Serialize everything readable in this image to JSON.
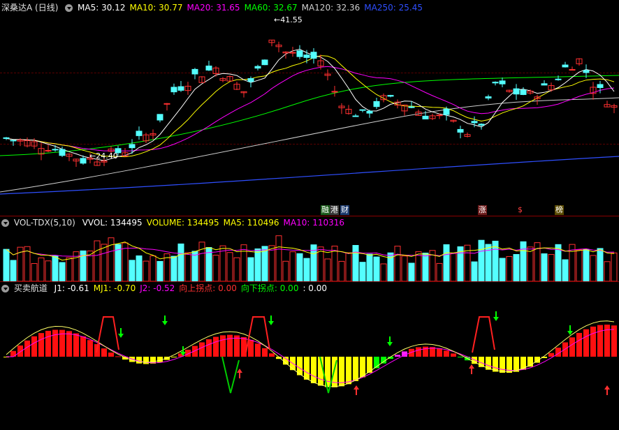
{
  "main_panel": {
    "title": "深桑达A (日线)",
    "indicators": [
      {
        "label": "MA5: 30.12",
        "color": "#ffffff"
      },
      {
        "label": "MA10: 30.77",
        "color": "#ffff00"
      },
      {
        "label": "MA20: 31.65",
        "color": "#ff00ff"
      },
      {
        "label": "MA60: 32.67",
        "color": "#00ff00"
      },
      {
        "label": "MA120: 32.36",
        "color": "#cfcfcf"
      },
      {
        "label": "MA250: 25.45",
        "color": "#2f4fff"
      }
    ],
    "high_label": "41.55",
    "low_label": "24.40",
    "event_markers": [
      {
        "text": "融",
        "bg": "#1a5c1a",
        "color": "#ffffff"
      },
      {
        "text": "港",
        "bg": "#3a3a3a",
        "color": "#ffffff"
      },
      {
        "text": "财",
        "bg": "#1c3a6e",
        "color": "#ffffff"
      },
      {
        "text": "涨",
        "bg": "#6e1c1c",
        "color": "#ffffff"
      },
      {
        "text": "$",
        "bg": "#000000",
        "color": "#ff4040"
      },
      {
        "text": "榜",
        "bg": "#5a4a00",
        "color": "#ffffff"
      }
    ]
  },
  "volume_panel": {
    "title": "VOL-TDX(5,10)",
    "indicators": [
      {
        "label": "VVOL: 134495",
        "color": "#ffffff"
      },
      {
        "label": "VOLUME: 134495",
        "color": "#ffff00"
      },
      {
        "label": "MA5: 110496",
        "color": "#ffff00"
      },
      {
        "label": "MA10: 110316",
        "color": "#ff00ff"
      }
    ]
  },
  "trade_panel": {
    "title": "买卖航道",
    "indicators": [
      {
        "label": "J1: -0.61",
        "color": "#ffffff"
      },
      {
        "label": "MJ1: -0.70",
        "color": "#ffff00"
      },
      {
        "label": "J2: -0.52",
        "color": "#ff00ff"
      },
      {
        "label": "向上拐点: 0.00",
        "color": "#ff3030"
      },
      {
        "label": "向下拐点: 0.00",
        "color": "#00ff00"
      },
      {
        "label": ": 0.00",
        "color": "#ffffff"
      }
    ]
  },
  "colors": {
    "up": "#ff3030",
    "down": "#54ffff",
    "ma5": "#ffffff",
    "ma10": "#ffff00",
    "ma20": "#ff00ff",
    "ma60": "#00ff00",
    "ma120": "#cfcfcf",
    "ma250": "#2f4fff"
  }
}
